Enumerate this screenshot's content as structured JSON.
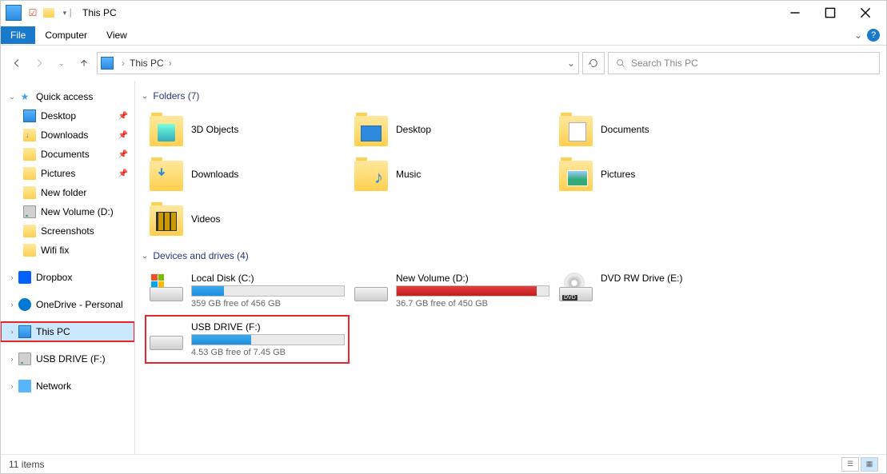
{
  "window": {
    "title": "This PC"
  },
  "ribbon": {
    "file": "File",
    "computer": "Computer",
    "view": "View"
  },
  "address": {
    "location": "This PC",
    "dropdown_icon": "chevron-down",
    "refresh_icon": "refresh"
  },
  "search": {
    "placeholder": "Search This PC"
  },
  "sidebar": {
    "quick_access": "Quick access",
    "quick_items": [
      {
        "label": "Desktop",
        "pinned": true,
        "icon": "monitor"
      },
      {
        "label": "Downloads",
        "pinned": true,
        "icon": "folder"
      },
      {
        "label": "Documents",
        "pinned": true,
        "icon": "folder"
      },
      {
        "label": "Pictures",
        "pinned": true,
        "icon": "folder"
      },
      {
        "label": "New folder",
        "pinned": false,
        "icon": "folder"
      },
      {
        "label": "New Volume (D:)",
        "pinned": false,
        "icon": "drive"
      },
      {
        "label": "Screenshots",
        "pinned": false,
        "icon": "folder"
      },
      {
        "label": "Wifi fix",
        "pinned": false,
        "icon": "folder"
      }
    ],
    "dropbox": "Dropbox",
    "onedrive": "OneDrive - Personal",
    "this_pc": "This PC",
    "usb_drive": "USB DRIVE (F:)",
    "network": "Network"
  },
  "groups": {
    "folders_header": "Folders (7)",
    "folders": [
      {
        "label": "3D Objects"
      },
      {
        "label": "Desktop"
      },
      {
        "label": "Documents"
      },
      {
        "label": "Downloads"
      },
      {
        "label": "Music"
      },
      {
        "label": "Pictures"
      },
      {
        "label": "Videos"
      }
    ],
    "drives_header": "Devices and drives (4)",
    "drives": [
      {
        "label": "Local Disk (C:)",
        "free": "359 GB free of 456 GB",
        "pct": 21,
        "color": "blue",
        "type": "os"
      },
      {
        "label": "New Volume (D:)",
        "free": "36.7 GB free of 450 GB",
        "pct": 92,
        "color": "red",
        "type": "hdd"
      },
      {
        "label": "DVD RW Drive (E:)",
        "free": "",
        "pct": 0,
        "color": "none",
        "type": "dvd"
      },
      {
        "label": "USB DRIVE (F:)",
        "free": "4.53 GB free of 7.45 GB",
        "pct": 39,
        "color": "blue",
        "type": "usb",
        "highlighted": true
      }
    ]
  },
  "status": {
    "items": "11 items"
  }
}
